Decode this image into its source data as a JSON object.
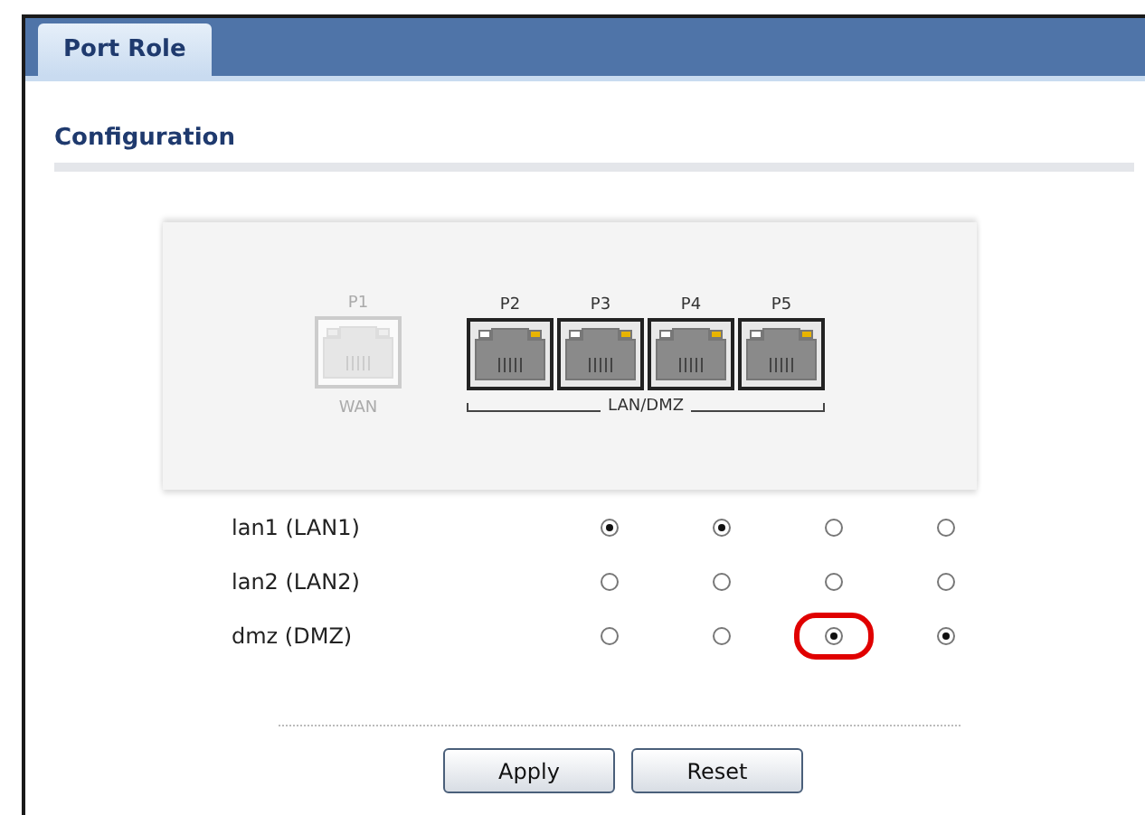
{
  "tabs": [
    {
      "label": "Port Role",
      "selected": true
    }
  ],
  "section_title": "Configuration",
  "ports": [
    {
      "label": "P1",
      "enabled": false
    },
    {
      "label": "P2",
      "enabled": true
    },
    {
      "label": "P3",
      "enabled": true
    },
    {
      "label": "P4",
      "enabled": true
    },
    {
      "label": "P5",
      "enabled": true
    }
  ],
  "port_groups": [
    {
      "label": "WAN",
      "kind": "single"
    },
    {
      "label": "LAN/DMZ",
      "kind": "bracket"
    }
  ],
  "roles": [
    {
      "name": "lan1 (LAN1)",
      "options": [
        {
          "selected": true,
          "highlighted": false
        },
        {
          "selected": true,
          "highlighted": false
        },
        {
          "selected": false,
          "highlighted": false
        },
        {
          "selected": false,
          "highlighted": false
        }
      ]
    },
    {
      "name": "lan2 (LAN2)",
      "options": [
        {
          "selected": false,
          "highlighted": false
        },
        {
          "selected": false,
          "highlighted": false
        },
        {
          "selected": false,
          "highlighted": false
        },
        {
          "selected": false,
          "highlighted": false
        }
      ]
    },
    {
      "name": "dmz (DMZ)",
      "options": [
        {
          "selected": false,
          "highlighted": false
        },
        {
          "selected": false,
          "highlighted": false
        },
        {
          "selected": true,
          "highlighted": true
        },
        {
          "selected": true,
          "highlighted": false
        }
      ]
    }
  ],
  "buttons": [
    "Apply",
    "Reset"
  ]
}
